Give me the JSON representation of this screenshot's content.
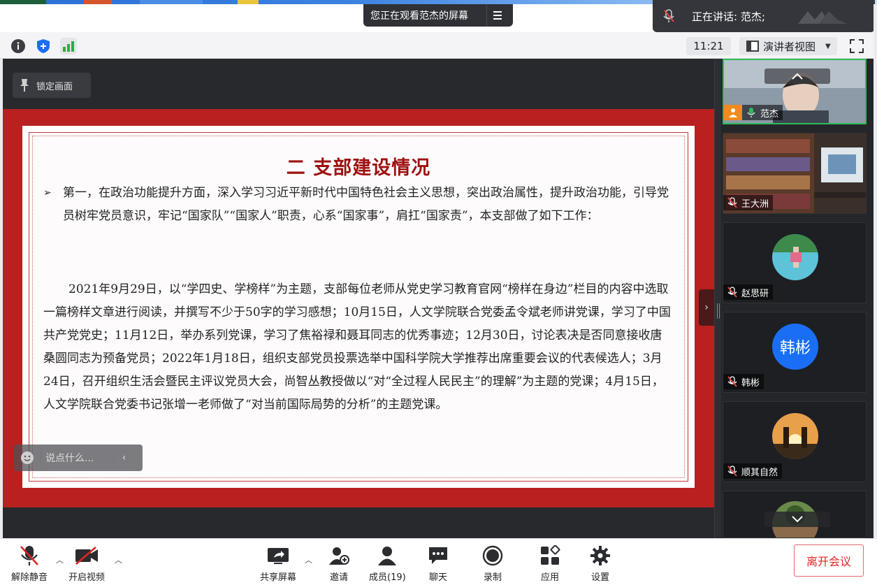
{
  "banners": {
    "viewing": "您正在观看范杰的屏幕",
    "speaking": "正在讲话: 范杰;"
  },
  "top_toolbar": {
    "time": "11:21",
    "view_mode": "演讲者视图"
  },
  "share": {
    "lock_label": "锁定画面",
    "chat_placeholder": "说点什么...",
    "slide": {
      "title": "二  支部建设情况",
      "para1": "第一，在政治功能提升方面，深入学习习近平新时代中国特色社会主义思想，突出政治属性，提升政治功能，引导党员树牢党员意识，牢记“国家队”“国家人”职责，心系“国家事”，肩扛“国家责”，本支部做了如下工作：",
      "para2": "2021年9月29日，以“学四史、学榜样”为主题，支部每位老师从党史学习教育官网“榜样在身边”栏目的内容中选取一篇榜样文章进行阅读，并撰写不少于50字的学习感想；10月15日，人文学院联合党委孟令斌老师讲党课，学习了中国共产党党史；11月12日，举办系列党课，学习了焦裕禄和聂耳同志的优秀事迹；12月30日，讨论表决是否同意接收唐桑圆同志为预备党员；2022年1月18日，组织支部党员投票选举中国科学院大学推荐出席重要会议的代表候选人；3月24日，召开组织生活会暨民主评议党员大会，尚智丛教授做以“对“全过程人民民主”的理解”为主题的党课；4月15日，人文学院联合党委书记张增一老师做了“对当前国际局势的分析”的主题党课。"
    }
  },
  "participants": [
    {
      "name": "范杰",
      "muted": false,
      "type": "video"
    },
    {
      "name": "王大洲",
      "muted": true,
      "type": "video"
    },
    {
      "name": "赵思研",
      "muted": true,
      "type": "photo"
    },
    {
      "name": "韩彬",
      "muted": true,
      "type": "initials",
      "initials": "韩彬",
      "color": "#1a6ef5"
    },
    {
      "name": "顺其自然",
      "muted": true,
      "type": "photo"
    }
  ],
  "bottom_toolbar": {
    "unmute": "解除静音",
    "start_video": "开启视频",
    "share_screen": "共享屏幕",
    "invite": "邀请",
    "members": "成员(19)",
    "chat": "聊天",
    "record": "录制",
    "apps": "应用",
    "settings": "设置",
    "leave": "离开会议"
  },
  "colors": {
    "slide_red": "#b8211f",
    "title_red": "#9d1111",
    "leave_red": "#e02424",
    "avatar_blue": "#1a6ef5"
  }
}
